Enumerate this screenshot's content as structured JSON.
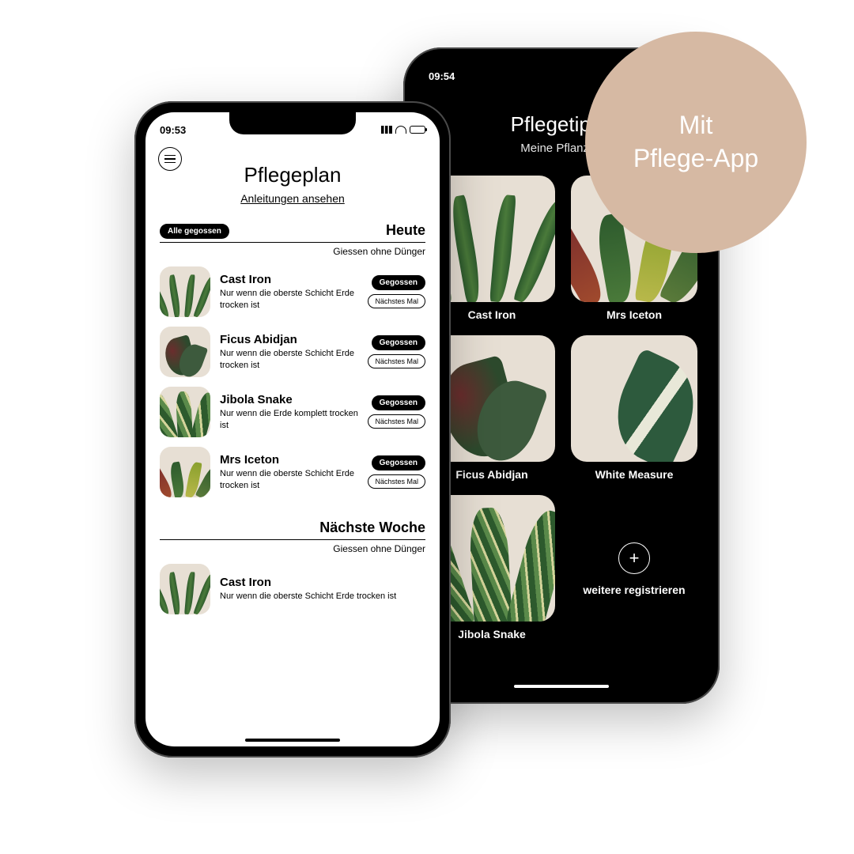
{
  "badge": {
    "line1": "Mit",
    "line2": "Pflege-App"
  },
  "back": {
    "time": "09:54",
    "title": "Pflegetipps",
    "subtitle": "Meine Pflanzen",
    "tiles": [
      {
        "name": "Cast Iron",
        "art": "castiron"
      },
      {
        "name": "Mrs Iceton",
        "art": "iceton"
      },
      {
        "name": "Ficus Abidjan",
        "art": "ficus"
      },
      {
        "name": "White Measure",
        "art": "white"
      },
      {
        "name": "Jibola Snake",
        "art": "snake"
      }
    ],
    "more": "weitere registrieren"
  },
  "front": {
    "time": "09:53",
    "title": "Pflegeplan",
    "link": "Anleitungen ansehen",
    "all_watered": "Alle gegossen",
    "today": {
      "heading": "Heute",
      "sub": "Giessen ohne Dünger",
      "items": [
        {
          "name": "Cast Iron",
          "desc": "Nur wenn die oberste Schicht Erde trocken ist",
          "art": "castiron"
        },
        {
          "name": "Ficus Abidjan",
          "desc": "Nur wenn die oberste Schicht Erde trocken ist",
          "art": "ficus"
        },
        {
          "name": "Jibola Snake",
          "desc": "Nur wenn die Erde komplett trocken ist",
          "art": "snake"
        },
        {
          "name": "Mrs Iceton",
          "desc": "Nur wenn die oberste Schicht Erde trocken ist",
          "art": "iceton"
        }
      ]
    },
    "next_week": {
      "heading": "Nächste Woche",
      "sub": "Giessen ohne Dünger",
      "items": [
        {
          "name": "Cast Iron",
          "desc": "Nur wenn die oberste Schicht Erde trocken ist",
          "art": "castiron"
        }
      ]
    },
    "btn_watered": "Gegossen",
    "btn_next": "Nächstes Mal"
  }
}
